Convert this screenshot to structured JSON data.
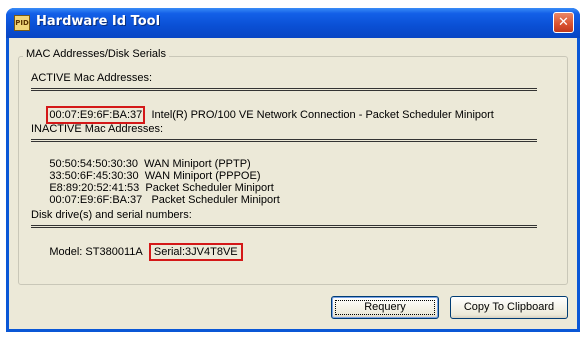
{
  "window": {
    "title": "Hardware Id Tool",
    "icon_label": "PID",
    "close_glyph": "✕"
  },
  "group": {
    "legend": "MAC Addresses/Disk Serials"
  },
  "active": {
    "heading": "ACTIVE Mac Addresses:",
    "separator": "================================================================================",
    "rows": [
      {
        "mac": "00:07:E9:6F:BA:37",
        "desc": "Intel(R) PRO/100 VE Network Connection - Packet Scheduler Miniport"
      }
    ]
  },
  "inactive": {
    "heading": "INACTIVE Mac Addresses:",
    "separator": "================================================================================",
    "rows": [
      {
        "mac": "50:50:54:50:30:30",
        "desc": "WAN Miniport (PPTP)"
      },
      {
        "mac": "33:50:6F:45:30:30",
        "desc": "WAN Miniport (PPPOE)"
      },
      {
        "mac": "E8:89:20:52:41:53",
        "desc": "Packet Scheduler Miniport"
      },
      {
        "mac": "00:07:E9:6F:BA:37",
        "desc": "Packet Scheduler Miniport"
      }
    ]
  },
  "disks": {
    "heading": "Disk drive(s) and serial numbers:",
    "separator": "================================================================================",
    "model": "Model: ST380011A",
    "serial": "Serial:3JV4T8VE"
  },
  "buttons": {
    "requery": "Requery",
    "copy": "Copy To Clipboard"
  },
  "colors": {
    "titlebar": "#0a4fd4",
    "highlight_box": "#d41818",
    "dialog_bg": "#ece9d8"
  }
}
